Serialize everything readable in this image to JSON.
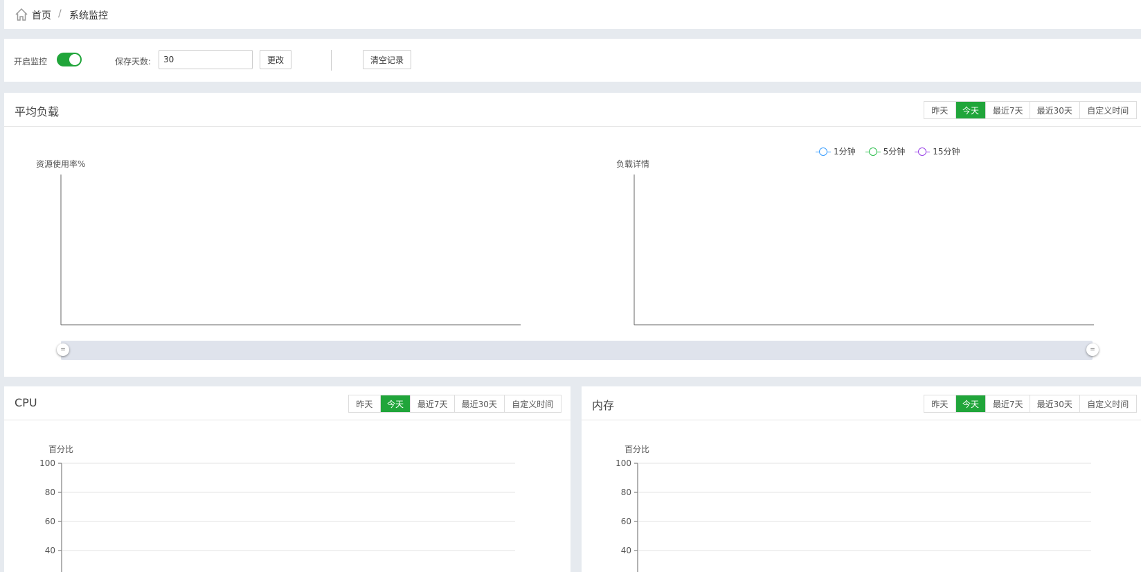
{
  "breadcrumb": {
    "home": "首页",
    "separator": "/",
    "current": "系统监控",
    "icon": "home-icon"
  },
  "controls": {
    "monitor_label": "开启监控",
    "monitor_enabled": true,
    "days_label": "保存天数:",
    "days_value": "30",
    "change_button": "更改",
    "clear_button": "清空记录"
  },
  "colors": {
    "accent": "#20a53a",
    "series_1min": "#3a9eff",
    "series_5min": "#2fbf4f",
    "series_15min": "#9a44e8"
  },
  "load_card": {
    "title": "平均负载",
    "tabs": [
      "昨天",
      "今天",
      "最近7天",
      "最近30天",
      "自定义时间"
    ],
    "active_tab": "今天",
    "left_chart_title": "资源使用率%",
    "right_chart_title": "负载详情",
    "legend": [
      "1分钟",
      "5分钟",
      "15分钟"
    ]
  },
  "cpu_card": {
    "title": "CPU",
    "tabs": [
      "昨天",
      "今天",
      "最近7天",
      "最近30天",
      "自定义时间"
    ],
    "active_tab": "今天",
    "axis_title": "百分比",
    "ticks": [
      "100",
      "80",
      "60",
      "40"
    ]
  },
  "mem_card": {
    "title": "内存",
    "tabs": [
      "昨天",
      "今天",
      "最近7天",
      "最近30天",
      "自定义时间"
    ],
    "active_tab": "今天",
    "axis_title": "百分比",
    "ticks": [
      "100",
      "80",
      "60",
      "40"
    ]
  }
}
